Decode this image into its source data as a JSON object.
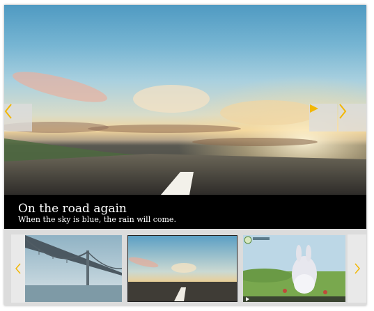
{
  "slide": {
    "title": "On the road again",
    "subtitle": "When the sky is blue, the rain will come."
  },
  "icons": {
    "prev": "chevron-left-icon",
    "next": "chevron-right-icon",
    "play": "play-icon"
  },
  "colors": {
    "accent": "#f2b705",
    "caption_bg": "#000000",
    "strip_bg": "#dcdcdc"
  },
  "thumbnails": [
    "bridge",
    "road",
    "video"
  ]
}
